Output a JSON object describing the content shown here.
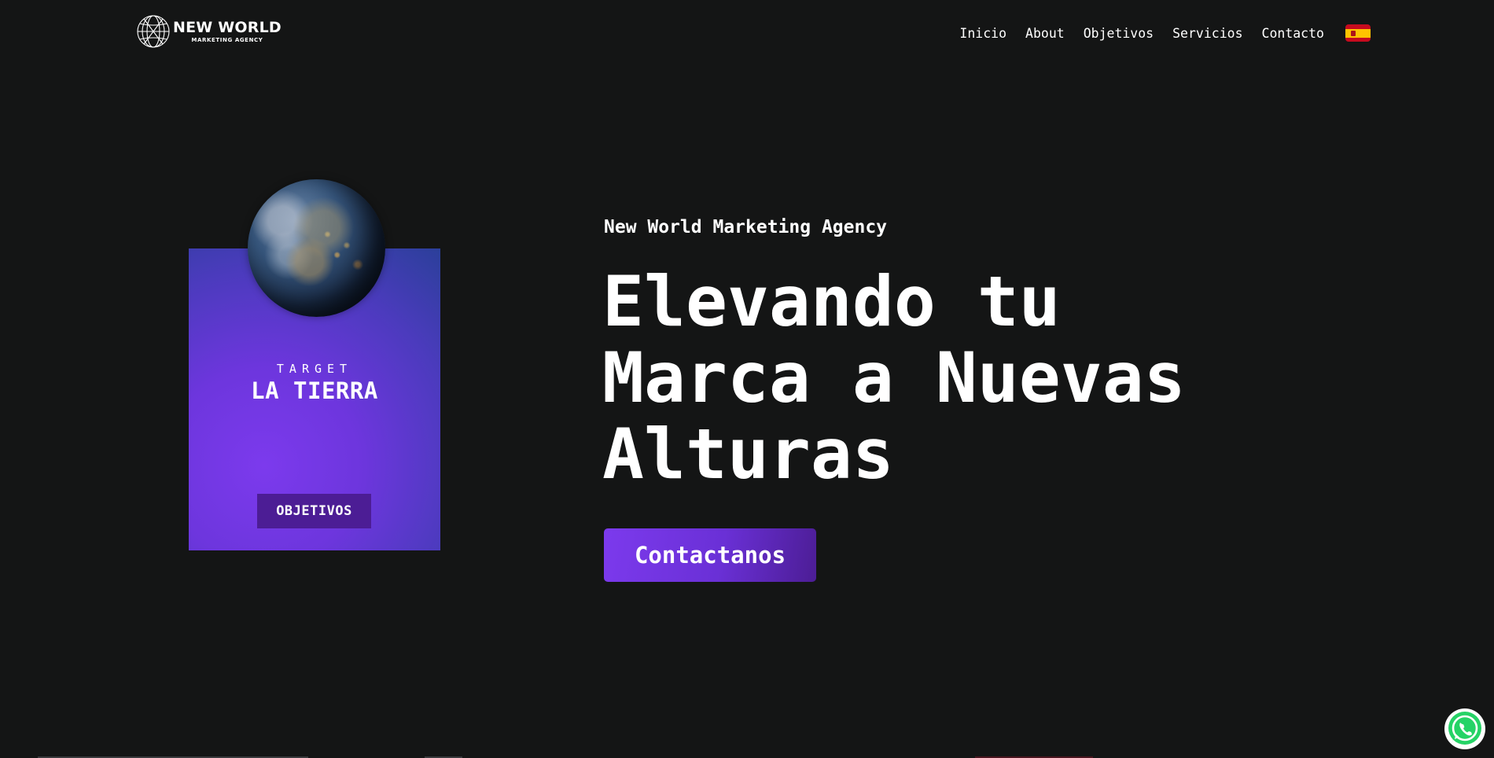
{
  "header": {
    "logo": {
      "title": "NEW WORLD",
      "subtitle": "MARKETING AGENCY",
      "icon": "globe-wireframe-icon"
    },
    "nav": [
      {
        "label": "Inicio"
      },
      {
        "label": "About"
      },
      {
        "label": "Objetivos"
      },
      {
        "label": "Servicios"
      },
      {
        "label": "Contacto"
      }
    ],
    "language_flag": {
      "icon": "spain-flag-icon"
    }
  },
  "card": {
    "image": "earth-globe",
    "eyebrow": "TARGET",
    "title": "LA TIERRA",
    "button_label": "OBJETIVOS",
    "gradient_colors": [
      "#7c3aed",
      "#2b3f9a"
    ]
  },
  "hero": {
    "eyebrow": "New World Marketing Agency",
    "title_lines": [
      "Elevando tu",
      "Marca a Nuevas",
      "Alturas"
    ],
    "cta_label": "Contactanos"
  },
  "floating": {
    "whatsapp_icon": "whatsapp-icon",
    "whatsapp_color": "#25d366"
  },
  "theme": {
    "background": "#141515",
    "accent": "#7c3aed",
    "accent_dark": "#4c1d95"
  }
}
